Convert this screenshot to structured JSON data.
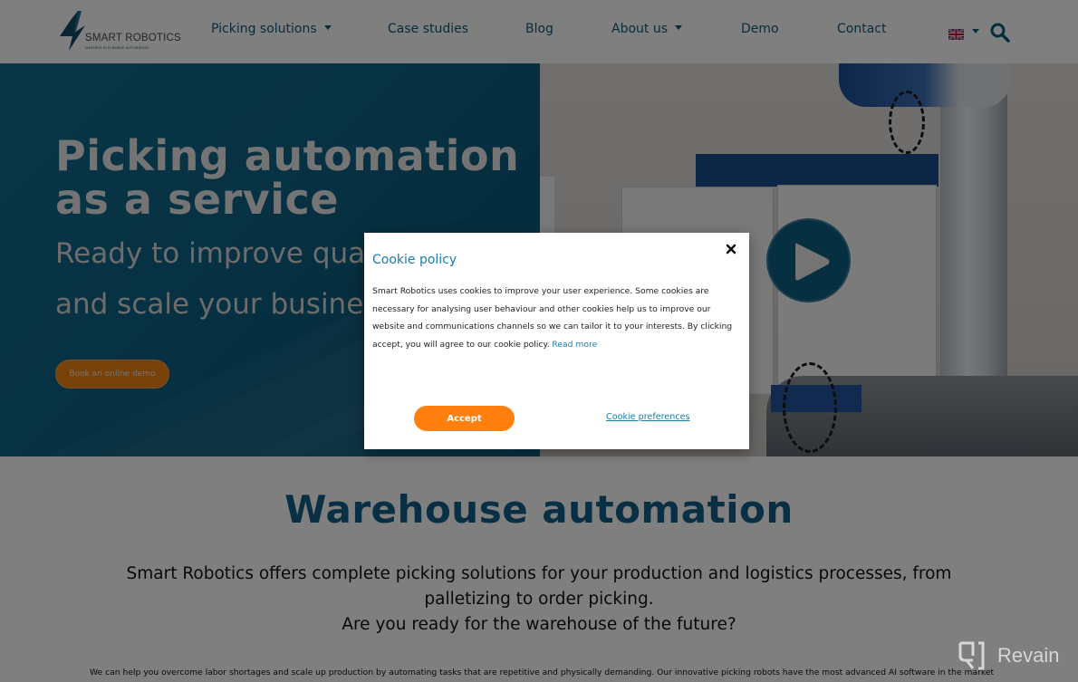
{
  "header": {
    "logo": {
      "name": "SMART ROBOTICS",
      "tagline": "MASTERS IN FLEXIBLE AUTOMATION"
    },
    "nav": [
      {
        "label": "Picking solutions",
        "has_dropdown": true
      },
      {
        "label": "Case studies",
        "has_dropdown": false
      },
      {
        "label": "Blog",
        "has_dropdown": false
      },
      {
        "label": "About us",
        "has_dropdown": true
      },
      {
        "label": "Demo",
        "has_dropdown": false
      },
      {
        "label": "Contact",
        "has_dropdown": false
      }
    ],
    "language_icon": "uk-flag-icon",
    "search_icon": "search-icon"
  },
  "hero": {
    "title_line1": "Picking automation",
    "title_line2": "as a service",
    "subtitle_line1": "Ready to improve quality",
    "subtitle_line2": "and scale your business?",
    "cta_label": "Book an online demo",
    "video_icon": "play-icon"
  },
  "section": {
    "title": "Warehouse automation",
    "lead_line1": "Smart Robotics offers complete picking solutions for your production and logistics processes, from palletizing to order picking.",
    "lead_line2": "Are you ready for the warehouse of the future?",
    "body": "We can help you overcome labor shortages and scale up production by automating tasks that are repetitive and physically demanding. Our innovative picking robots have the most advanced AI software in the market"
  },
  "cookie_modal": {
    "title": "Cookie policy",
    "body": "Smart Robotics uses cookies to improve your user experience. Some cookies are necessary for analysing user behaviour and other cookies help us to improve our website and communications channels so we can tailor it to your interests. By clicking accept, you will agree to our cookie policy.",
    "read_more": "Read more",
    "accept_label": "Accept",
    "preferences_label": "Cookie preferences",
    "close_icon": "close-icon"
  },
  "watermark": {
    "label": "Revain"
  },
  "colors": {
    "brand_blue": "#105f86",
    "link_blue": "#1a7ea9",
    "accent_orange": "#ff7f0f",
    "hero_bg": "#0f6588"
  }
}
